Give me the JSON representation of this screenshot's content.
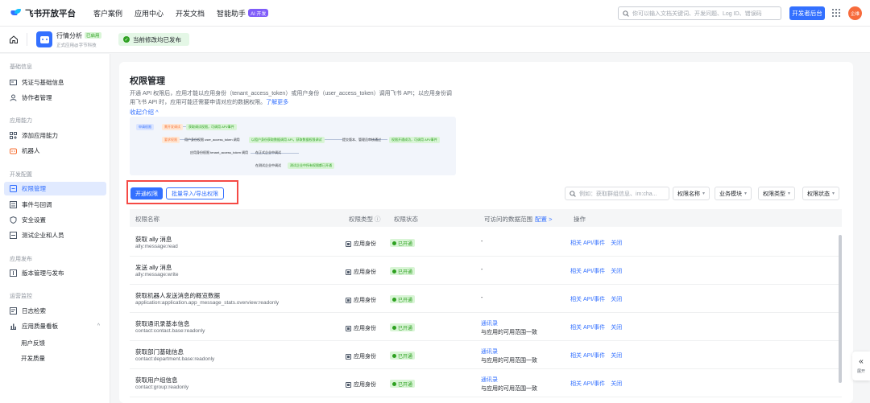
{
  "topnav": {
    "brand": "飞书开放平台",
    "links": [
      "客户案例",
      "应用中心",
      "开发文档",
      "智能助手"
    ],
    "ai_badge": "AI 开发",
    "search_placeholder": "你可以输入文档关键词、开发问题、Log ID、错误码",
    "dev_console": "开发者后台",
    "avatar_text": "企维"
  },
  "appbar": {
    "app_name": "行情分析",
    "online_badge": "已启用",
    "app_sub": "正式应用@字节科技",
    "published": "当前修改均已发布"
  },
  "sidebar": {
    "groups": [
      "基础信息",
      "应用能力",
      "开发配置",
      "应用发布",
      "运营监控"
    ],
    "items": [
      "凭证与基础信息",
      "协作者管理",
      "添加应用能力",
      "机器人",
      "权限管理",
      "事件与回调",
      "安全设置",
      "测试企业和人员",
      "版本管理与发布",
      "日志检索",
      "应用质量看板"
    ],
    "subitems": [
      "用户反馈",
      "开发质量"
    ]
  },
  "main": {
    "title": "权限管理",
    "desc_line1": "开通 API 权限后，应用才能以应用身份（tenant_access_token）或用户身份（user_access_token）调用飞书 API；以应用身份调",
    "desc_line2": "用飞书 API 时，应用可能还需要申请对应的数据权限。",
    "learn_more": "了解更多",
    "collapse": "收起介绍 ^",
    "flow": {
      "n1": "申请权限",
      "n2": "要求权限",
      "n3": "需开发调试",
      "n4": "获取调试权限，可调用 API/事件",
      "n5": "用户身份权限 user_access_token 调用",
      "n6": "以租户身份获取数据调用 API，获取数据权限调试",
      "n7": "提交版本、管理员审核通过",
      "n8": "权限开通成功，可调用 API/事件",
      "n9": "应用身份权限 tenant_access_token 调用",
      "n10": "在正式企业中调试",
      "n11": "在测试企业中调试",
      "n12": "测试企业中所有权限都已开通"
    },
    "btn_enable": "开通权限",
    "btn_batch": "批量导入/导出权限",
    "filter_placeholder": "例如：获取群组信息、im:cha...",
    "filters": [
      "权限名称",
      "业务模块",
      "权限类型",
      "权限状态"
    ]
  },
  "table": {
    "headers": [
      "权限名称",
      "权限类型",
      "权限状态",
      "可访问的数据范围",
      "操作"
    ],
    "config_link": "配置 >",
    "rows": [
      {
        "name": "获取 ally 消息",
        "code": "ally:message:read",
        "type": "应用身份",
        "status": "已开通",
        "scope_link": "",
        "scope": "-",
        "op1": "相关 API/事件",
        "op2": "关闭"
      },
      {
        "name": "发送 ally 消息",
        "code": "ally:message:write",
        "type": "应用身份",
        "status": "已开通",
        "scope_link": "",
        "scope": "-",
        "op1": "相关 API/事件",
        "op2": "关闭"
      },
      {
        "name": "获取机器人发送消息的概览数据",
        "code": "application:application.app_message_stats.overview:readonly",
        "type": "应用身份",
        "status": "已开通",
        "scope_link": "",
        "scope": "-",
        "op1": "相关 API/事件",
        "op2": "关闭"
      },
      {
        "name": "获取通讯录基本信息",
        "code": "contact:contact.base:readonly",
        "type": "应用身份",
        "status": "已开通",
        "scope_link": "通讯录",
        "scope": "与应用的可用范围一致",
        "op1": "相关 API/事件",
        "op2": "关闭"
      },
      {
        "name": "获取部门基础信息",
        "code": "contact:department.base:readonly",
        "type": "应用身份",
        "status": "已开通",
        "scope_link": "通讯录",
        "scope": "与应用的可用范围一致",
        "op1": "相关 API/事件",
        "op2": "关闭"
      },
      {
        "name": "获取用户组信息",
        "code": "contact:group:readonly",
        "type": "应用身份",
        "status": "已开通",
        "scope_link": "通讯录",
        "scope": "与应用的可用范围一致",
        "op1": "相关 API/事件",
        "op2": "关闭"
      }
    ]
  },
  "float": {
    "label": "展开"
  }
}
